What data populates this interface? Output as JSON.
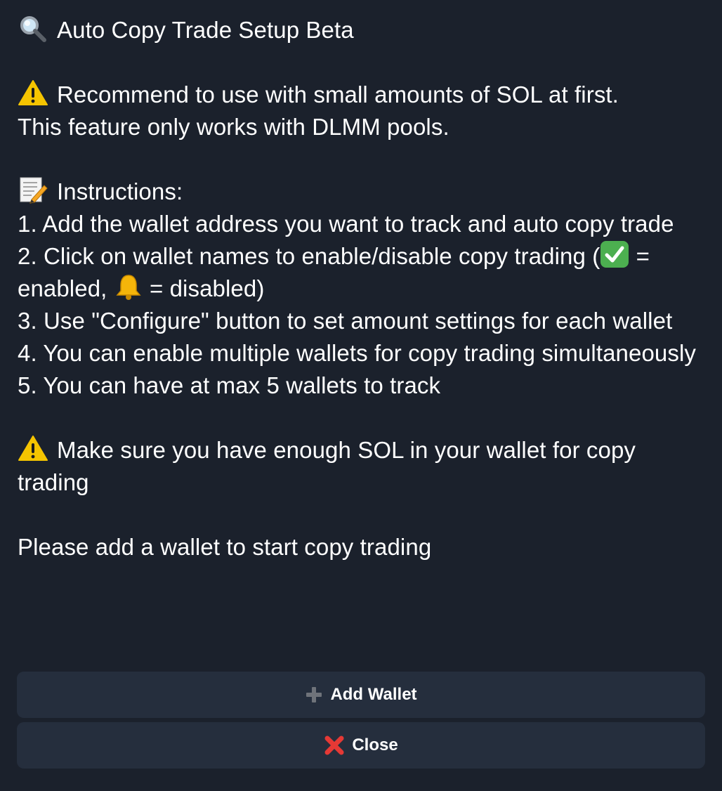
{
  "message": {
    "title": "Auto Copy Trade Setup Beta",
    "warning1_line1": "Recommend to use with small amounts of SOL at first.",
    "warning1_line2": "This feature only works with DLMM pools.",
    "instructions_heading": "Instructions:",
    "step1": "1. Add the wallet address you want to track and auto copy trade",
    "step2_part1": "2. Click on wallet names to enable/disable copy trading (",
    "step2_part2": " = enabled, ",
    "step2_part3": " = disabled)",
    "step3": "3. Use \"Configure\" button to set amount settings for each wallet",
    "step4": "4. You can enable multiple wallets for copy trading simultaneously",
    "step5": "5. You can have at max 5 wallets to track",
    "warning2": "Make sure you have enough SOL in your wallet for copy trading",
    "prompt": "Please add a wallet to start copy trading"
  },
  "icons": {
    "title_icon": "magnifying-glass",
    "warning_icon": "warning-sign",
    "instructions_icon": "memo",
    "enabled_icon": "check-mark-button",
    "disabled_icon": "bell",
    "add_icon": "plus",
    "close_icon": "cross-mark"
  },
  "buttons": {
    "add_wallet_label": "Add Wallet",
    "close_label": "Close"
  },
  "colors": {
    "background": "#1b212c",
    "button_background": "#252e3d",
    "text": "#ffffff",
    "warning_yellow": "#f5c400",
    "check_green": "#4caf50",
    "close_red": "#e53935"
  }
}
